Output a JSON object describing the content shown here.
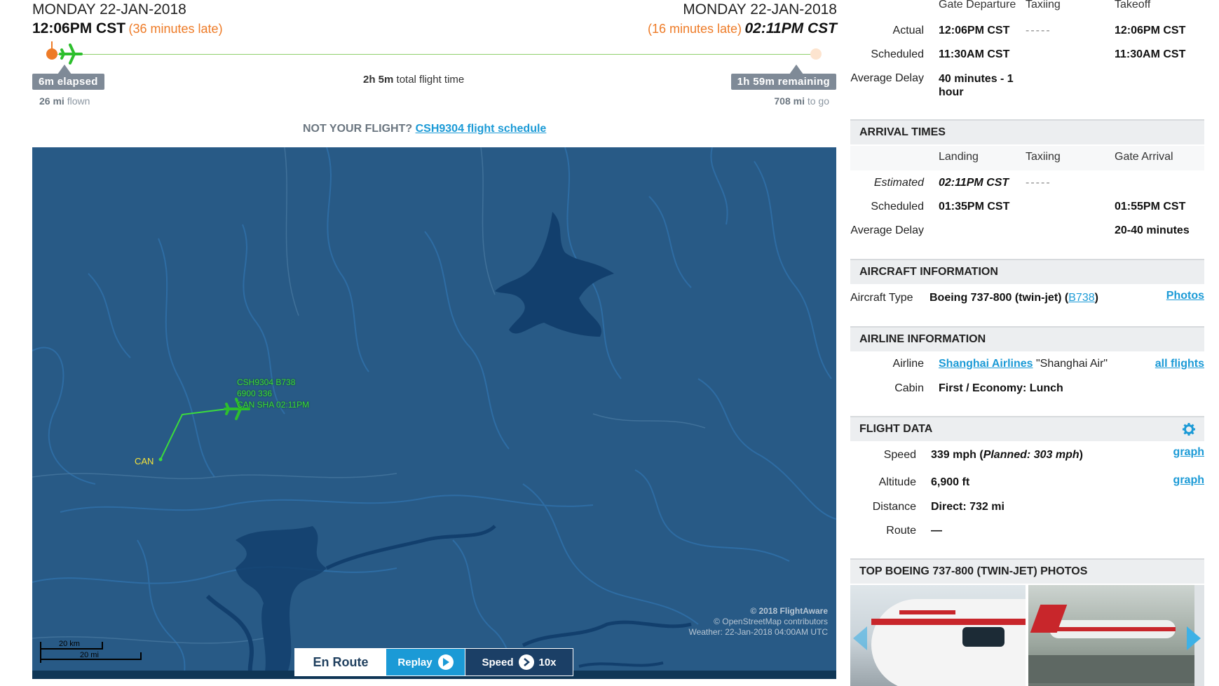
{
  "departure": {
    "date": "MONDAY 22-JAN-2018",
    "time": "12:06PM CST",
    "late": "(36 minutes late)"
  },
  "arrival": {
    "date": "MONDAY 22-JAN-2018",
    "time": "02:11PM CST",
    "late": "(16 minutes late)"
  },
  "progress": {
    "elapsed_value": "6m",
    "elapsed_label": "elapsed",
    "flown_value": "26 mi",
    "flown_label": "flown",
    "total_value": "2h 5m",
    "total_label": "total flight time",
    "remaining_value": "1h 59m",
    "remaining_label": "remaining",
    "togo_value": "708 mi",
    "togo_label": "to go",
    "fraction": 0.048
  },
  "not_your_flight": {
    "prefix": "NOT YOUR FLIGHT?",
    "link": "CSH9304 flight schedule"
  },
  "map": {
    "flight_label_1": "CSH9304 B738",
    "flight_label_2": "6900 336",
    "flight_label_3": "CAN SHA 02:11PM",
    "origin_label": "CAN",
    "attribution_1": "© 2018 FlightAware",
    "attribution_2": "© OpenStreetMap contributors",
    "attribution_3": "Weather: 22-Jan-2018 04:00AM UTC",
    "scale_km": "20 km",
    "scale_mi": "20 mi",
    "controls": {
      "en_route": "En Route",
      "replay": "Replay",
      "speed_label": "Speed",
      "speed_value": "10x"
    }
  },
  "departure_times": {
    "col_headers": [
      "Gate Departure",
      "Taxiing",
      "Takeoff"
    ],
    "rows": [
      {
        "label": "Actual",
        "gate": "12:06PM CST",
        "taxi": "-----",
        "takeoff": "12:06PM CST"
      },
      {
        "label": "Scheduled",
        "gate": "11:30AM CST",
        "taxi": "",
        "takeoff": "11:30AM CST"
      }
    ],
    "avg_delay_label": "Average Delay",
    "avg_delay_value_1": "40 minutes - 1",
    "avg_delay_value_2": "hour"
  },
  "arrival_times": {
    "title": "ARRIVAL TIMES",
    "col_headers": [
      "Landing",
      "Taxiing",
      "Gate Arrival"
    ],
    "rows": [
      {
        "label": "Estimated",
        "landing": "02:11PM CST",
        "taxi": "-----",
        "gate": ""
      },
      {
        "label": "Scheduled",
        "landing": "01:35PM CST",
        "taxi": "",
        "gate": "01:55PM CST"
      }
    ],
    "avg_delay_label": "Average Delay",
    "avg_delay_value": "20-40 minutes"
  },
  "aircraft": {
    "title": "AIRCRAFT INFORMATION",
    "type_label": "Aircraft Type",
    "type_value": "Boeing 737-800 (twin-jet) (",
    "type_code": "B738",
    "type_close": ")",
    "photos_link": "Photos"
  },
  "airline": {
    "title": "AIRLINE INFORMATION",
    "airline_label": "Airline",
    "airline_link": "Shanghai Airlines",
    "airline_alias": " \"Shanghai Air\"",
    "all_flights_link": "all flights",
    "cabin_label": "Cabin",
    "cabin_value": "First / Economy: Lunch"
  },
  "flight_data": {
    "title": "FLIGHT DATA",
    "speed_label": "Speed",
    "speed_value": "339 mph (",
    "speed_planned": "Planned: 303 mph",
    "speed_close": ")",
    "altitude_label": "Altitude",
    "altitude_value": "6,900 ft",
    "distance_label": "Distance",
    "distance_value": "Direct: 732 mi",
    "route_label": "Route",
    "route_value": "—",
    "graph_link": "graph"
  },
  "photos": {
    "title": "TOP BOEING 737-800 (TWIN-JET) PHOTOS"
  },
  "colors": {
    "accent": "#1b9ad6",
    "late": "#ee7b27",
    "map_bg": "#285a86",
    "flight_track": "#3cdc3c"
  }
}
